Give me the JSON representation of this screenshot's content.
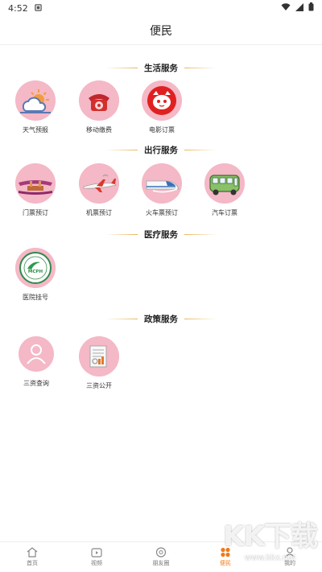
{
  "status_bar": {
    "time": "4:52"
  },
  "header": {
    "title": "便民"
  },
  "sections": {
    "life": {
      "title": "生活服务",
      "items": [
        {
          "label": "天气预报",
          "icon": "weather-icon"
        },
        {
          "label": "移动缴费",
          "icon": "telephone-icon"
        },
        {
          "label": "电影订票",
          "icon": "cat-logo-icon"
        }
      ]
    },
    "travel": {
      "title": "出行服务",
      "items": [
        {
          "label": "门票预订",
          "icon": "gate-icon"
        },
        {
          "label": "机票预订",
          "icon": "airplane-icon"
        },
        {
          "label": "火车票预订",
          "icon": "train-icon"
        },
        {
          "label": "汽车订票",
          "icon": "bus-icon"
        }
      ]
    },
    "medical": {
      "title": "医疗服务",
      "items": [
        {
          "label": "医院挂号",
          "icon": "hospital-logo-icon",
          "logo_text": "MCPH"
        }
      ]
    },
    "policy": {
      "title": "政策服务",
      "items": [
        {
          "label": "三资查询",
          "icon": "person-icon"
        },
        {
          "label": "三资公开",
          "icon": "document-icon"
        }
      ]
    }
  },
  "tabbar": {
    "items": [
      {
        "label": "首页",
        "icon": "home-icon"
      },
      {
        "label": "视频",
        "icon": "video-icon"
      },
      {
        "label": "朋友圈",
        "icon": "moments-icon"
      },
      {
        "label": "便民",
        "icon": "grid-icon",
        "active": true
      },
      {
        "label": "我的",
        "icon": "profile-icon"
      }
    ]
  },
  "watermark": {
    "big": "KK下载",
    "small": "www.kkx.net"
  },
  "colors": {
    "accent": "#f07a1a",
    "icon_bg": "#f4b8c6",
    "section_line": "#e8b45a"
  }
}
